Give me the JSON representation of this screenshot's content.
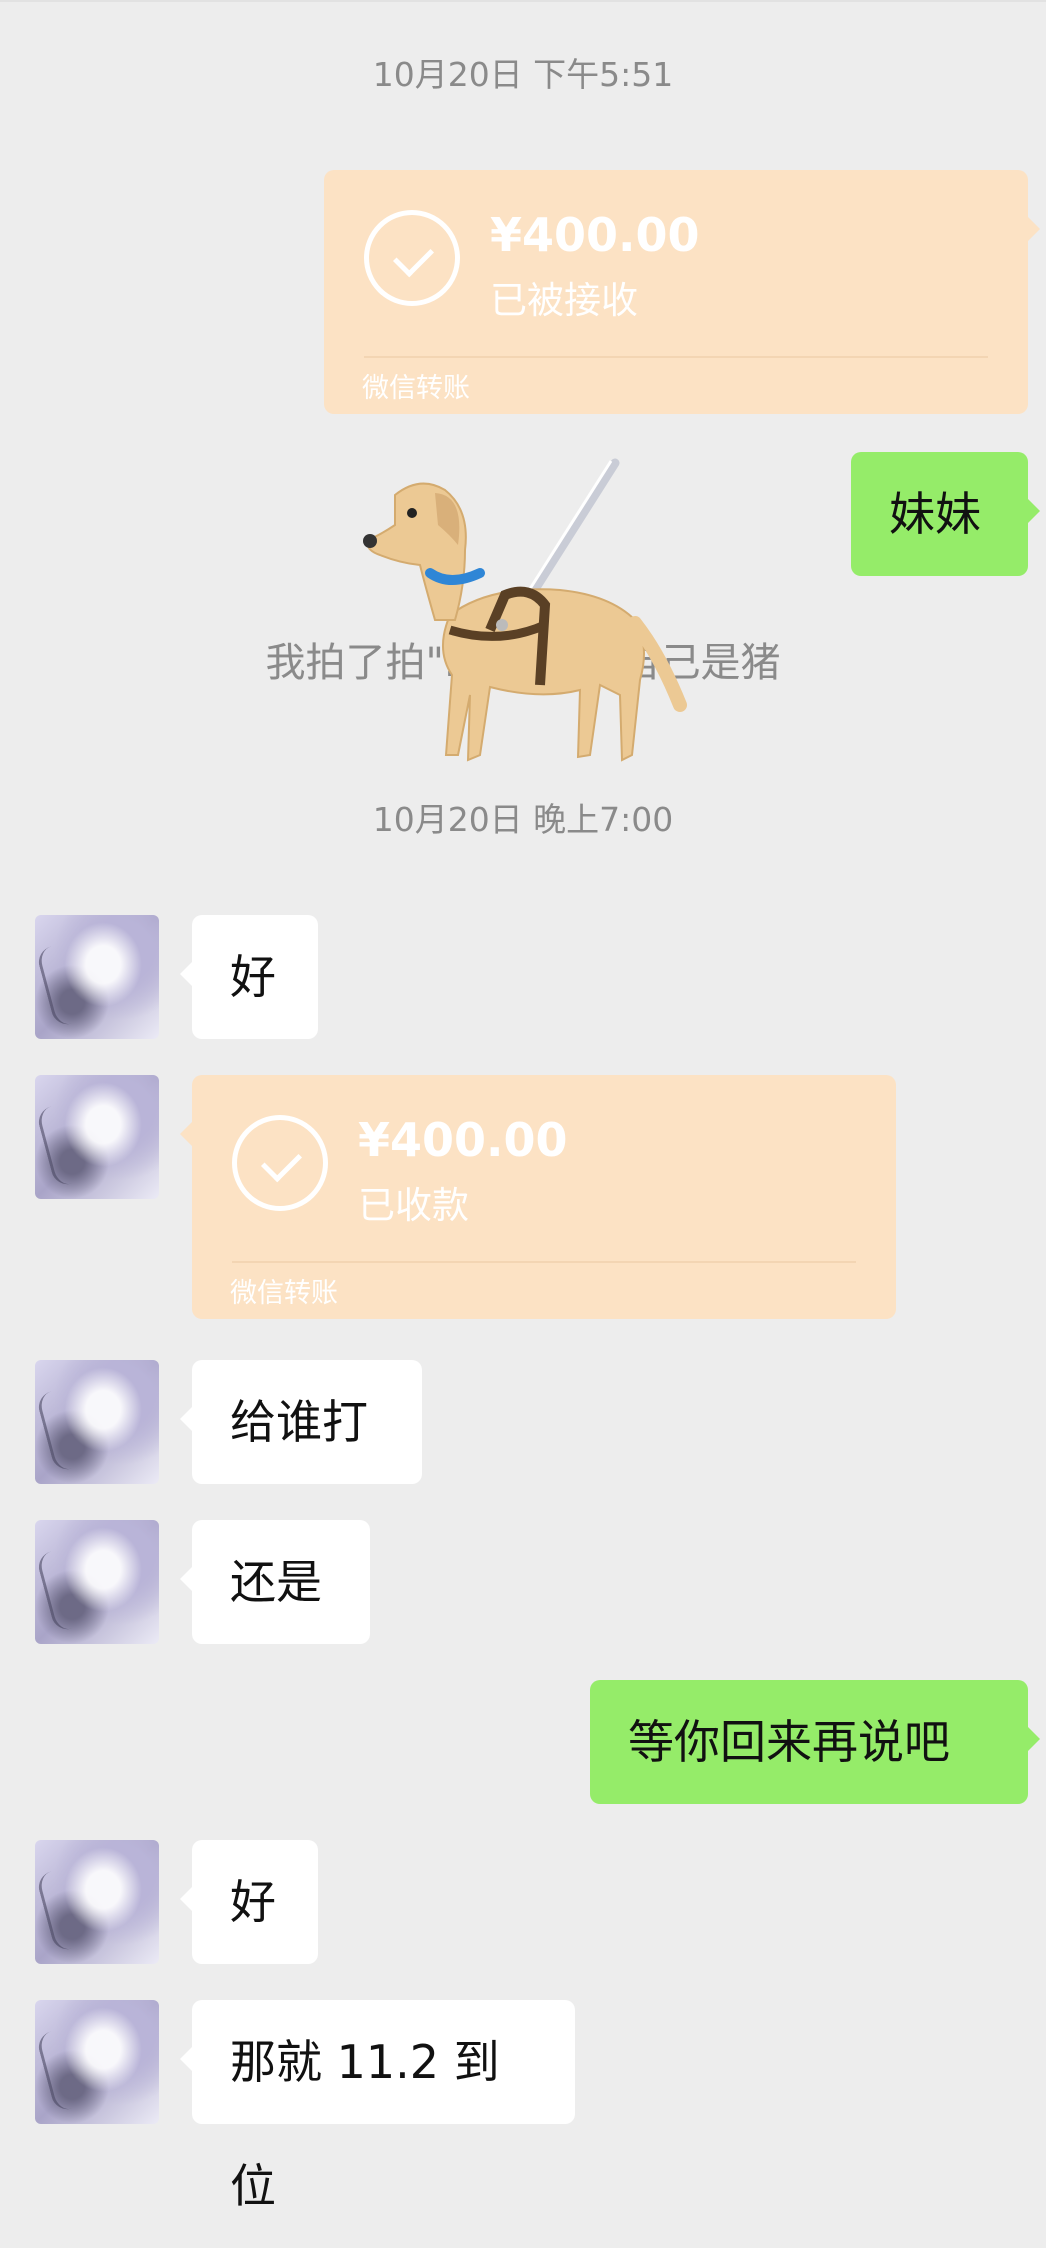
{
  "timestamps": [
    "10月20日 下午5:51",
    "10月20日 晚上7:00"
  ],
  "transfer_out": {
    "amount": "¥400.00",
    "status": "已被接收",
    "label": "微信转账"
  },
  "sent_1": "妹妹",
  "system_message": "我拍了拍\"...\"的并说自己是猪",
  "received_1": "好",
  "transfer_in": {
    "amount": "¥400.00",
    "status": "已收款",
    "label": "微信转账"
  },
  "received_2": "给谁打",
  "received_3": "还是",
  "sent_2": "等你回来再说吧",
  "received_4": "好",
  "received_5": "那就 11.2 到位",
  "colors": {
    "background": "#ededed",
    "sent_bubble": "#95ec69",
    "received_bubble": "#ffffff",
    "transfer": "#fce2c4"
  },
  "icons": {
    "transfer_check": "check-circle-icon",
    "sticker": "guide-dog-sticker"
  }
}
